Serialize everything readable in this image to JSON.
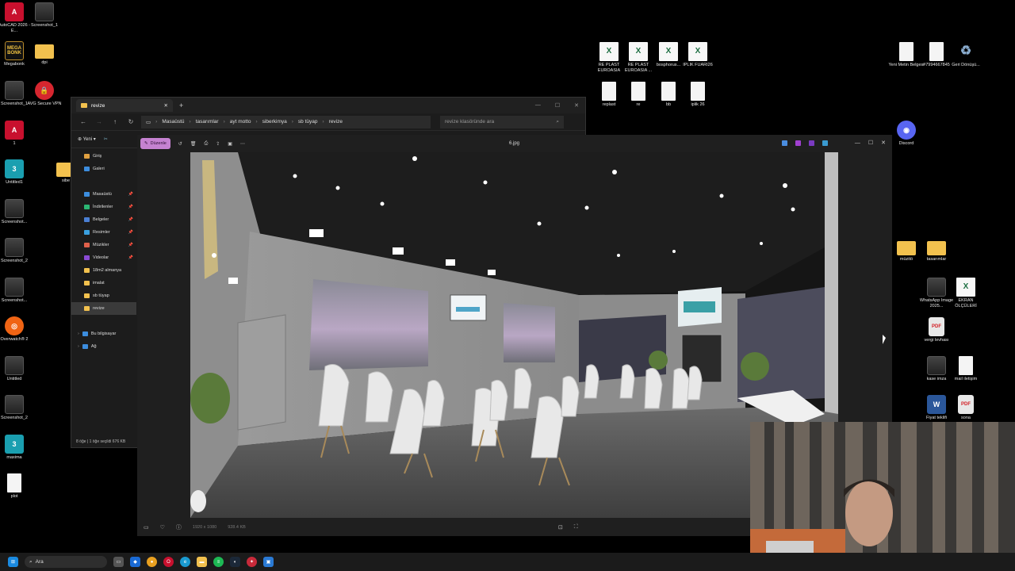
{
  "desktop": {
    "left_icons": [
      {
        "label": "AutoCAD 2026 - E...",
        "icon": "autocad-icon",
        "glyph": "A"
      },
      {
        "label": "Screenshot_1",
        "icon": "image-thumb-icon",
        "glyph": ""
      },
      {
        "label": "Megabonk",
        "icon": "megabonk-icon",
        "glyph": "MEGA BONK"
      },
      {
        "label": "dpi",
        "icon": "folder-icon",
        "glyph": ""
      },
      {
        "label": "Screenshot_1",
        "icon": "image-thumb-icon",
        "glyph": ""
      },
      {
        "label": "AVG Secure VPN",
        "icon": "avg-icon",
        "glyph": "🔒"
      },
      {
        "label": "1",
        "icon": "autocad-icon",
        "glyph": "A"
      },
      {
        "label": "Untitled1",
        "icon": "3dsmax-icon",
        "glyph": "3"
      },
      {
        "label": "sibe",
        "icon": "folder-icon",
        "glyph": ""
      },
      {
        "label": "Screenshot...",
        "icon": "image-thumb-icon",
        "glyph": ""
      },
      {
        "label": "Screenshot_2",
        "icon": "image-thumb-icon",
        "glyph": ""
      },
      {
        "label": "Screenshot...",
        "icon": "image-thumb-icon",
        "glyph": ""
      },
      {
        "label": "Overwatch® 2",
        "icon": "overwatch-icon",
        "glyph": "◎"
      },
      {
        "label": "Untitled",
        "icon": "image-thumb-icon",
        "glyph": ""
      },
      {
        "label": "Screenshot_2",
        "icon": "image-thumb-icon",
        "glyph": ""
      },
      {
        "label": "maxima",
        "icon": "3dsmax-icon",
        "glyph": "3"
      },
      {
        "label": "plot",
        "icon": "document-icon",
        "glyph": ""
      }
    ],
    "top_icons": [
      {
        "label": "RE PLAST EUROASIA",
        "icon": "excel-icon",
        "glyph": "X"
      },
      {
        "label": "RE PLAST EUROASIA ...",
        "icon": "excel-icon",
        "glyph": "X"
      },
      {
        "label": "bosphorus...",
        "icon": "excel-icon",
        "glyph": "X"
      },
      {
        "label": "IPLIK FUARI26",
        "icon": "excel-icon",
        "glyph": "X"
      },
      {
        "label": "replast",
        "icon": "document-icon",
        "glyph": ""
      },
      {
        "label": "re",
        "icon": "document-icon",
        "glyph": ""
      },
      {
        "label": "bb",
        "icon": "document-icon",
        "glyph": ""
      },
      {
        "label": "iplik 26",
        "icon": "document-icon",
        "glyph": ""
      }
    ],
    "right_icons": [
      {
        "label": "Yeni Metin Belgesi",
        "icon": "document-icon",
        "glyph": ""
      },
      {
        "label": "#7994667845",
        "icon": "document-icon",
        "glyph": ""
      },
      {
        "label": "Geri Dönüşü...",
        "icon": "recycle-bin-icon",
        "glyph": "♻"
      },
      {
        "label": "Discord",
        "icon": "discord-icon",
        "glyph": "◉"
      },
      {
        "label": "müzitö",
        "icon": "folder-icon",
        "glyph": ""
      },
      {
        "label": "tasarımlar",
        "icon": "folder-icon",
        "glyph": ""
      },
      {
        "label": "WhatsApp Image 2025...",
        "icon": "image-thumb-icon",
        "glyph": ""
      },
      {
        "label": "EKRAN ÖLÇÜLERİ",
        "icon": "excel-icon",
        "glyph": "X"
      },
      {
        "label": "vergi levhası",
        "icon": "pdf-icon",
        "glyph": "PDF"
      },
      {
        "label": "kase imza",
        "icon": "image-thumb-icon",
        "glyph": ""
      },
      {
        "label": "mail iletişim",
        "icon": "document-icon",
        "glyph": ""
      },
      {
        "label": "Fiyat teklifi",
        "icon": "word-icon",
        "glyph": "W"
      },
      {
        "label": "sona",
        "icon": "pdf-icon",
        "glyph": "PDF"
      }
    ]
  },
  "explorer": {
    "tab_title": "revize",
    "breadcrumb": [
      "Masaüstü",
      "tasarımlar",
      "ayt motto",
      "siberkimya",
      "sb tüyap",
      "revize"
    ],
    "search_placeholder": "revize klasöründe ara",
    "new_label": "Yeni",
    "sidebar_top": [
      {
        "label": "Giriş",
        "color": "#e0a040"
      },
      {
        "label": "Galeri",
        "color": "#3c8dde"
      }
    ],
    "sidebar_pinned": [
      {
        "label": "Masaüstü",
        "color": "#3c8dde"
      },
      {
        "label": "İndirilenler",
        "color": "#2bb673"
      },
      {
        "label": "Belgeler",
        "color": "#4a7fd4"
      },
      {
        "label": "Resimler",
        "color": "#3aa0e0"
      },
      {
        "label": "Müzikler",
        "color": "#e0604a"
      },
      {
        "label": "Videolar",
        "color": "#8a4ad4"
      }
    ],
    "sidebar_folders": [
      "18m2 almanya",
      "imalat",
      "sb tüyap",
      "revize"
    ],
    "sidebar_bottom": [
      "Bu bilgisayar",
      "Ağ"
    ],
    "status": "8 öğe   |   1 öğe seçildi  676 KB"
  },
  "photos": {
    "edit_label": "Düzenle",
    "file_name": "6.jpg",
    "dimensions": "1920 x 1080",
    "file_size": "928.4 KB"
  },
  "taskbar": {
    "search_label": "Ara"
  },
  "colors": {
    "accent_edit": "#c582d1",
    "folder": "#f2c14e"
  }
}
